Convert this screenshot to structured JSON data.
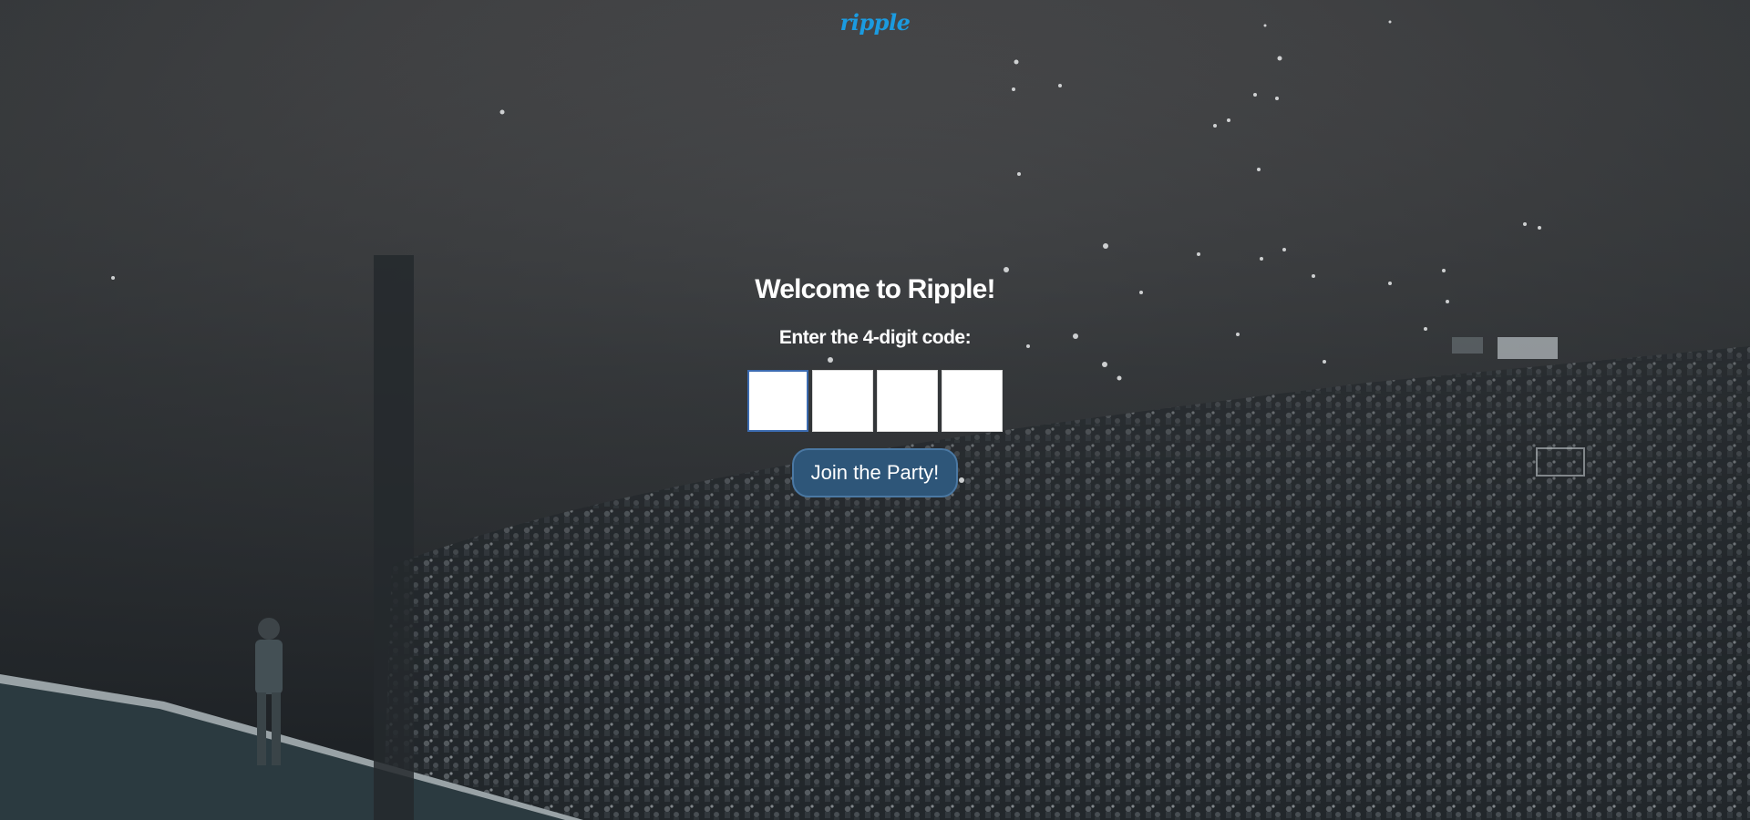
{
  "app": {
    "logo_text": "ripple"
  },
  "join": {
    "title": "Welcome to Ripple!",
    "prompt": "Enter the 4-digit code:",
    "code_digits": [
      "",
      "",
      "",
      ""
    ],
    "button_label": "Join the Party!"
  },
  "colors": {
    "logo": "#1b9be0",
    "button_bg": "#2e5679",
    "button_border": "#4a78a3",
    "active_input_border": "#3c6bb0"
  }
}
